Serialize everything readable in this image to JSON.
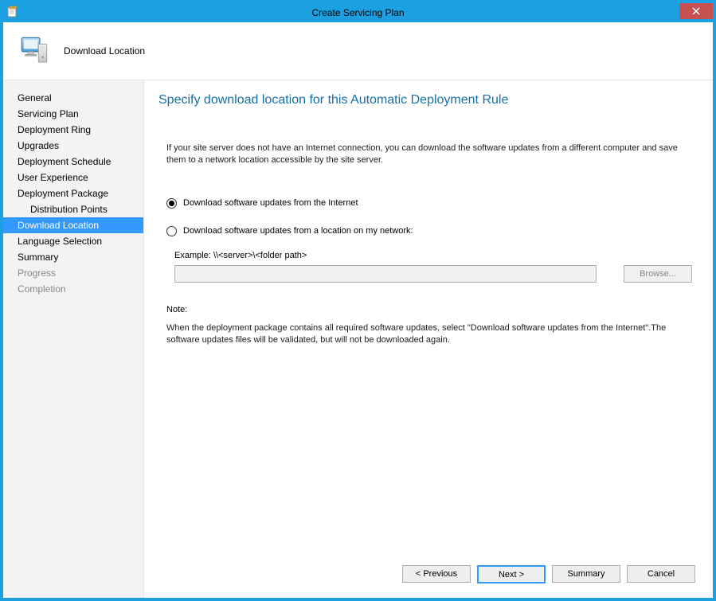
{
  "titlebar": {
    "title": "Create Servicing Plan"
  },
  "header": {
    "title": "Download Location"
  },
  "sidebar": {
    "items": [
      {
        "label": "General"
      },
      {
        "label": "Servicing Plan"
      },
      {
        "label": "Deployment Ring"
      },
      {
        "label": "Upgrades"
      },
      {
        "label": "Deployment Schedule"
      },
      {
        "label": "User Experience"
      },
      {
        "label": "Deployment Package"
      },
      {
        "label": "Distribution Points"
      },
      {
        "label": "Download Location"
      },
      {
        "label": "Language Selection"
      },
      {
        "label": "Summary"
      },
      {
        "label": "Progress"
      },
      {
        "label": "Completion"
      }
    ]
  },
  "main": {
    "heading": "Specify download location for this Automatic Deployment Rule",
    "intro": "If your site server does not have an Internet connection, you can download the software updates from a different computer and save them to a network location accessible by the site server.",
    "radio_internet": "Download software updates from the Internet",
    "radio_network": "Download software updates from a location on my network:",
    "example_label": "Example: \\\\<server>\\<folder path>",
    "path_value": "",
    "browse_label": "Browse...",
    "note_label": "Note:",
    "note_text": "When the deployment package contains all required software updates, select \"Download  software updates from the Internet\".The software updates files will be validated, but will not be downloaded again."
  },
  "buttons": {
    "previous": "< Previous",
    "next": "Next >",
    "summary": "Summary",
    "cancel": "Cancel"
  }
}
